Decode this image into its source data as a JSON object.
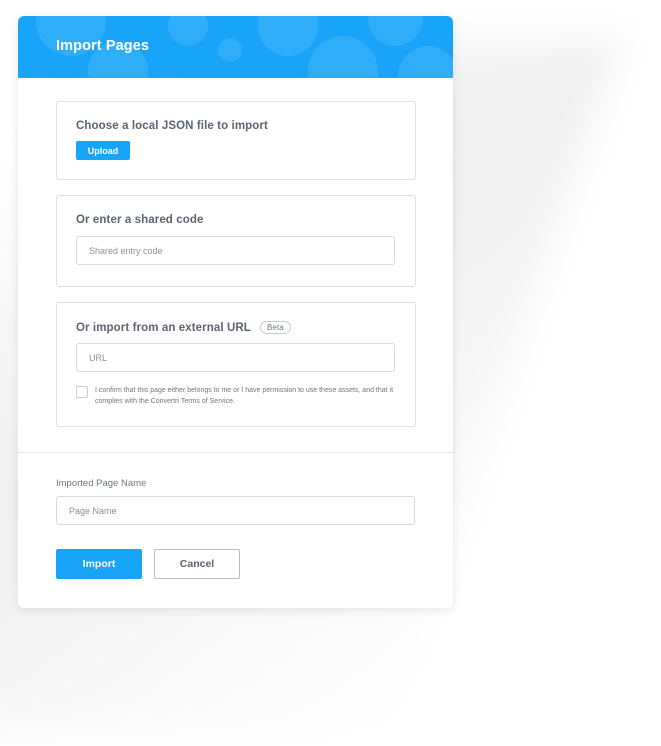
{
  "dialog": {
    "title": "Import Pages"
  },
  "upload_card": {
    "heading": "Choose a local JSON file to import",
    "button_label": "Upload"
  },
  "shared_code_card": {
    "heading": "Or enter a shared code",
    "input_placeholder": "Shared entry code",
    "input_value": ""
  },
  "url_card": {
    "heading": "Or import from an external URL",
    "badge": "Beta",
    "input_placeholder": "URL",
    "input_value": "",
    "confirm_checked": false,
    "confirm_text": "I confirm that this page either belongs to me or I have permission to use these assets, and that it complies with the Convertri Terms of Service."
  },
  "page_name": {
    "label": "Imported Page Name",
    "input_placeholder": "Page Name",
    "input_value": ""
  },
  "actions": {
    "import_label": "Import",
    "cancel_label": "Cancel"
  },
  "colors": {
    "accent": "#17a4f9",
    "text": "#5c6470",
    "border": "#dcdfe3"
  }
}
